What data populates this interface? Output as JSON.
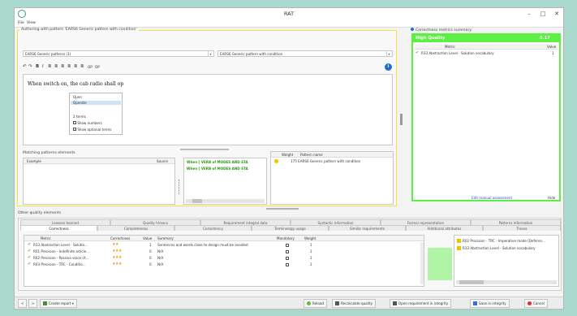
{
  "app": {
    "title": "RAT"
  },
  "menu": {
    "file": "File",
    "view": "View"
  },
  "authoring": {
    "legend": "Authoring with pattern 'EARS6 Generic pattern with condition'",
    "patterns_select": "EARS6 Generic patterns (1)",
    "pattern_select": "EARS6 Generic pattern with condition",
    "editor_text": "When switch on, the cab radio shall op",
    "toolbar": {
      "undo": "↶",
      "redo": "↷",
      "bold": "B",
      "italic": "I",
      "u1": "≣",
      "u2": "≣",
      "u3": "≣",
      "u4": "≣",
      "u5": "≣",
      "u6": "≣",
      "op": "OP",
      "op2": "OP"
    }
  },
  "popup": {
    "item1": "Open",
    "item2": "Operate",
    "count": "2 terms",
    "show_numbers": "Show numbers",
    "show_optional": "Show optional terms"
  },
  "matching": {
    "legend": "Matching patterns elements",
    "col_example": "Example",
    "col_source": "Source",
    "rule1": "When [ VERB of MODES AND STA",
    "rule2": "When [ VERB of MODES AND STA"
  },
  "weights": {
    "col_weight": "Weight",
    "col_pattern": "Pattern name",
    "row_pattern": "175 EARS6 Generic pattern with condition"
  },
  "summary": {
    "legend": "Correctness metrics summary",
    "quality": "High Quality",
    "score": "0.17",
    "col_metric": "Metric",
    "col_value": "Value",
    "row_metric": "R33 Abstraction Level - Solution vocabulary",
    "row_value": "1",
    "link": "Edit manual assessment",
    "link_right": "Hide"
  },
  "other": {
    "legend": "Other quality elements",
    "tabs_row1": [
      "Lessons learned",
      "Quality hirsons",
      "Requirement integral data",
      "Syntactic information",
      "Formal representation",
      "Patterns information"
    ],
    "tabs_row2": [
      "Correctness",
      "Completeness",
      "Consistency",
      "Terminology usage",
      "Similar requirements",
      "Additional attributes",
      "Traces"
    ],
    "cols": {
      "metric": "Metric",
      "correctness": "Correctness",
      "value": "Value",
      "summary": "Summary",
      "mandatory": "Mandatory",
      "weight": "Weight"
    },
    "rows": [
      {
        "metric": "R33 Abstraction Level - Solutio...",
        "stars": "★★",
        "value": "1",
        "summary": "Sentences and words close to design must be avoided",
        "weight": "1"
      },
      {
        "metric": "R01 Precision - Indefinite article...",
        "stars": "★★★",
        "value": "0",
        "summary": "N/A",
        "weight": "1"
      },
      {
        "metric": "R02 Precision - Passive voice (A...",
        "stars": "★★★",
        "value": "0",
        "summary": "N/A",
        "weight": "1"
      },
      {
        "metric": "R03 Precision - TRC - Conditio...",
        "stars": "★★★",
        "value": "0",
        "summary": "N/A",
        "weight": "1"
      }
    ],
    "tree1": "R02 Precision - TRC - Imperative mode (Deferen...",
    "tree2": "R33 Abstraction Level - Solution vocabulary"
  },
  "footer": {
    "back": "<",
    "forward": ">",
    "create_report": "Create report",
    "reload": "Reload",
    "recalculate": "Recalculate quality",
    "open_integrity": "Open requirement in integrity",
    "save_integrity": "Save in integrity",
    "cancel": "Cancel"
  },
  "colors": {
    "accent_green": "#5cf042",
    "highlight_yellow": "#f5e23a",
    "ok_green": "#2aa36b",
    "cancel_red": "#d9342b"
  }
}
